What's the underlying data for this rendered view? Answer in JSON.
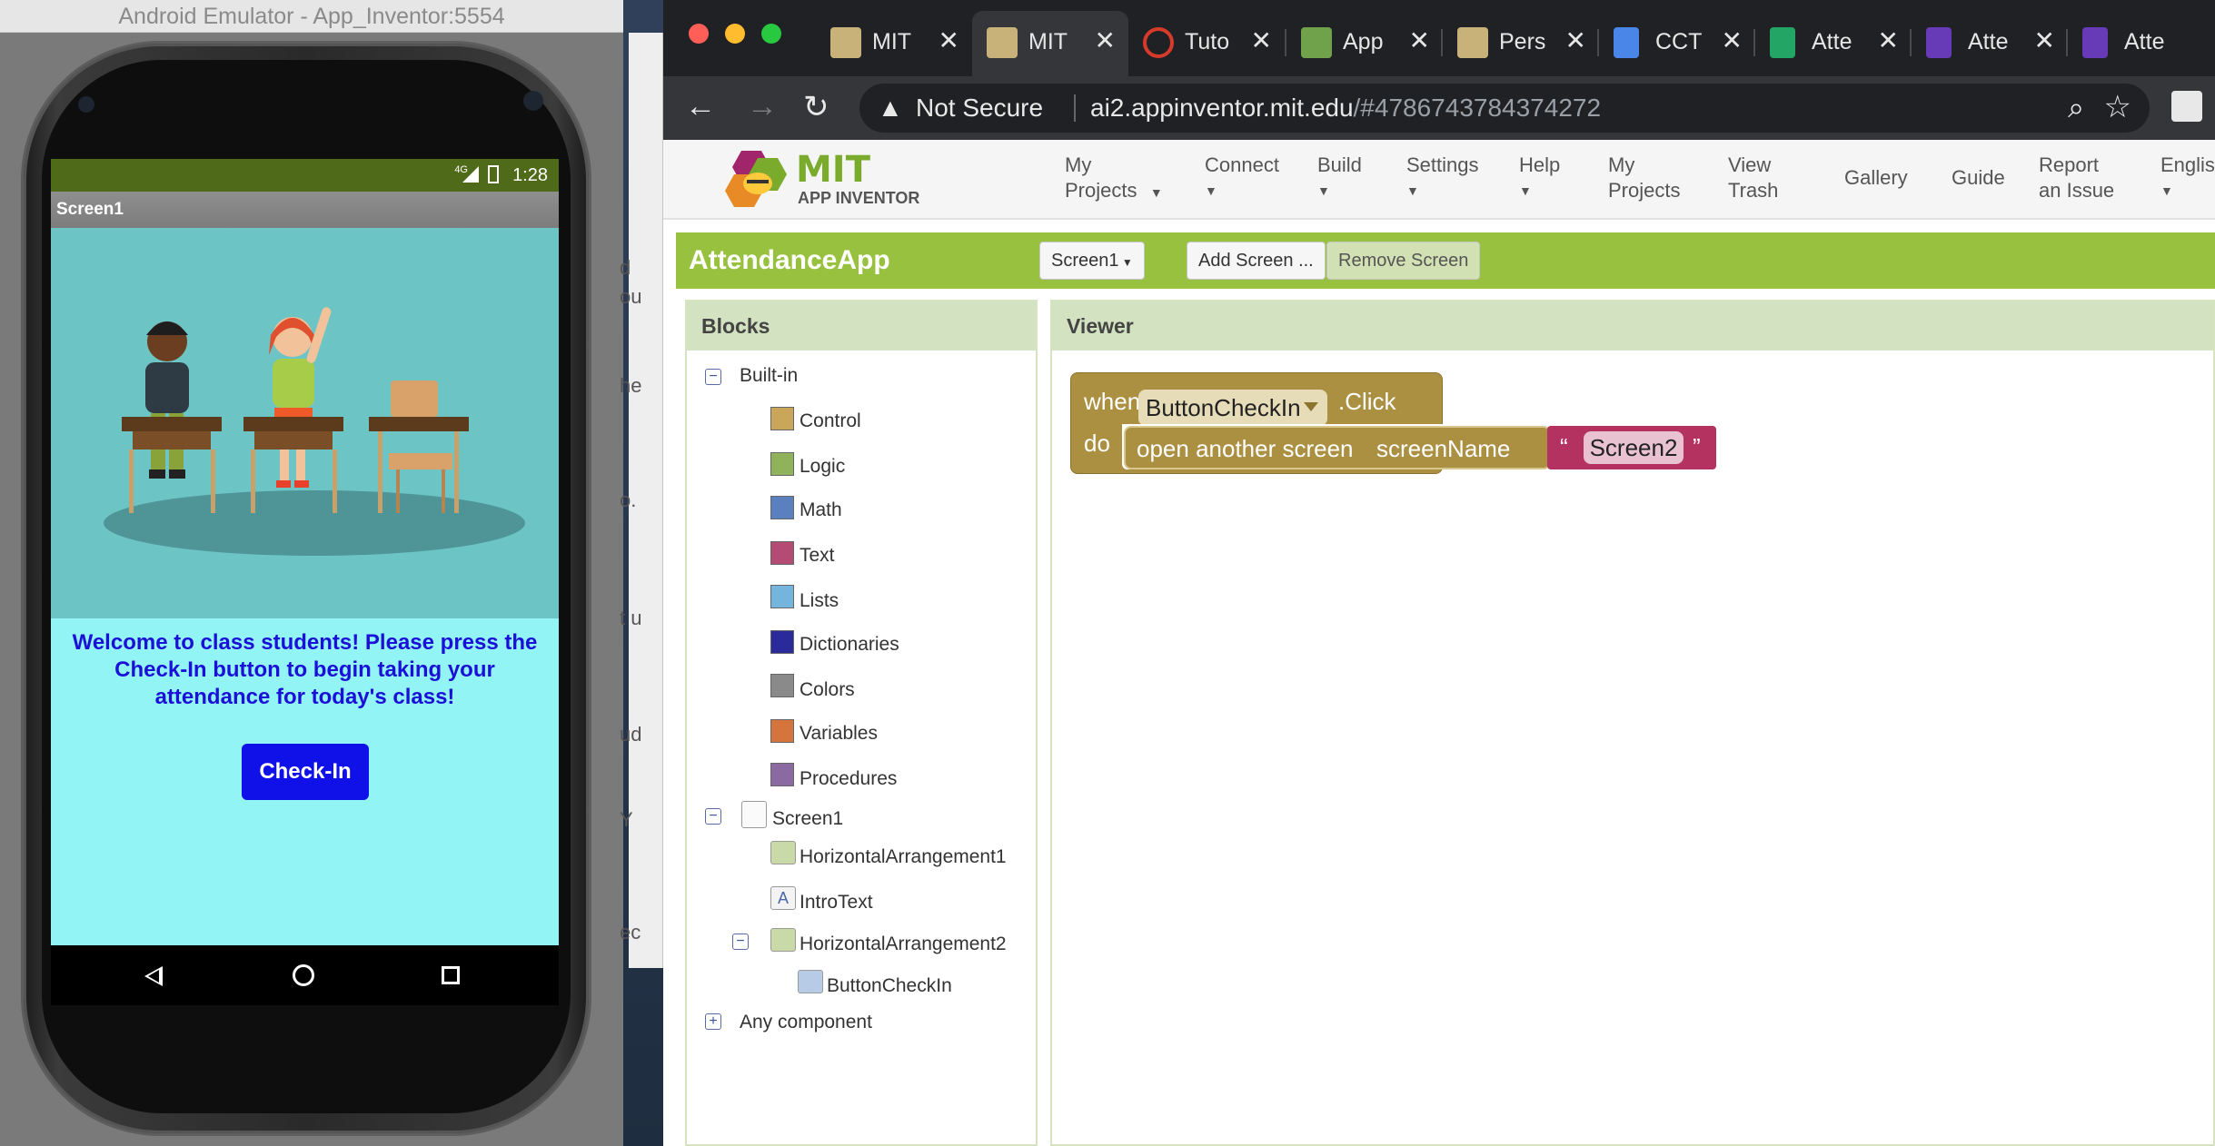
{
  "emulator": {
    "window_title": "Android Emulator - App_Inventor:5554",
    "status_network": "4G",
    "status_time": "1:28",
    "screen_title": "Screen1",
    "welcome_text": "Welcome to class students! Please press the Check-In button to begin taking your attendance for today's class!",
    "checkin_button": "Check-In"
  },
  "desktop_fragments": [
    "d",
    "ou",
    "he",
    "o.",
    "t u",
    "ud",
    "Y",
    "ec"
  ],
  "browser": {
    "tabs": [
      {
        "label": "MIT",
        "active": false,
        "favicon": "app-inventor-icon"
      },
      {
        "label": "MIT",
        "active": true,
        "favicon": "app-inventor-icon"
      },
      {
        "label": "Tuto",
        "active": false,
        "favicon": "tutorial-icon"
      },
      {
        "label": "App",
        "active": false,
        "favicon": "app-icon"
      },
      {
        "label": "Pers",
        "active": false,
        "favicon": "app-inventor-icon"
      },
      {
        "label": "CCT",
        "active": false,
        "favicon": "docs-icon"
      },
      {
        "label": "Atte",
        "active": false,
        "favicon": "sheets-icon"
      },
      {
        "label": "Atte",
        "active": false,
        "favicon": "forms-icon"
      },
      {
        "label": "Atte",
        "active": false,
        "favicon": "forms-icon"
      }
    ],
    "security": "Not Secure",
    "url_host": "ai2.appinventor.mit.edu",
    "url_path": "/#4786743784374272"
  },
  "appinventor": {
    "logo_mit": "MIT",
    "logo_sub": "APP INVENTOR",
    "nav": [
      {
        "label": "My Projects",
        "dropdown": true
      },
      {
        "label": "Connect",
        "dropdown": true
      },
      {
        "label": "Build",
        "dropdown": true
      },
      {
        "label": "Settings",
        "dropdown": true
      },
      {
        "label": "Help",
        "dropdown": true
      },
      {
        "label": "My Projects",
        "dropdown": false
      },
      {
        "label": "View Trash",
        "dropdown": false
      },
      {
        "label": "Gallery",
        "dropdown": false
      },
      {
        "label": "Guide",
        "dropdown": false
      },
      {
        "label": "Report an Issue",
        "dropdown": false
      },
      {
        "label": "English",
        "dropdown": true
      }
    ],
    "project_name": "AttendanceApp",
    "screen_select": "Screen1",
    "add_screen": "Add Screen ...",
    "remove_screen": "Remove Screen",
    "blocks_title": "Blocks",
    "viewer_title": "Viewer",
    "builtin_label": "Built-in",
    "builtin": [
      {
        "label": "Control",
        "color": "#c9a65a"
      },
      {
        "label": "Logic",
        "color": "#8fb25a"
      },
      {
        "label": "Math",
        "color": "#5b80c0"
      },
      {
        "label": "Text",
        "color": "#b34b75"
      },
      {
        "label": "Lists",
        "color": "#74b5de"
      },
      {
        "label": "Dictionaries",
        "color": "#2a2a9a"
      },
      {
        "label": "Colors",
        "color": "#8a8a8a"
      },
      {
        "label": "Variables",
        "color": "#d5743c"
      },
      {
        "label": "Procedures",
        "color": "#8a6aa0"
      }
    ],
    "components": {
      "screen": "Screen1",
      "ha1": "HorizontalArrangement1",
      "intro": "IntroText",
      "ha2": "HorizontalArrangement2",
      "button": "ButtonCheckIn"
    },
    "any_component": "Any component",
    "block": {
      "when": "when",
      "component": "ButtonCheckIn",
      "event": ".Click",
      "do": "do",
      "action": "open another screen",
      "param": "screenName",
      "open_quote": "“",
      "value": "Screen2",
      "close_quote": "”"
    }
  }
}
